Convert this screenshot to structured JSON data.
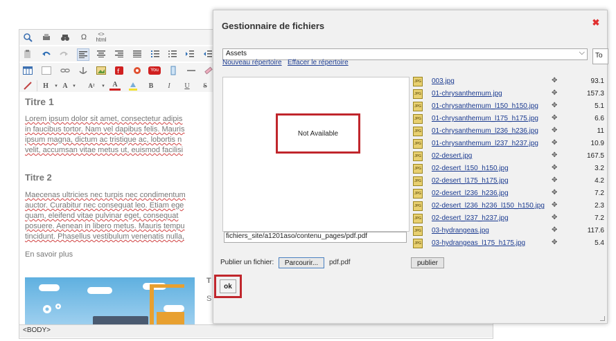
{
  "editor": {
    "heading1": "Titre 1",
    "para1_line1": "Lorem ipsum dolor sit amet, consectetur adipis",
    "para1_line2": "in faucibus tortor. Nam vel dapibus felis. Mauris",
    "para1_line3": "ipsum magna, dictum ac tristique ac, lobortis n",
    "para1_line4": "velit, accumsan vitae metus ut, euismod facilisi",
    "heading2": "Titre 2",
    "para2_line1": "Maecenas ultricies nec turpis nec condimentum",
    "para2_line2": "auctor. Curabitur nec consequat leo. Etiam ege",
    "para2_line3": "quam, eleifend vitae pulvinar eget, consequat",
    "para2_line4": "posuere. Aenean in libero metus. Mauris tempu",
    "para2_line5": "tincidunt. Phasellus vestibulum venenatis nulla,",
    "more_text": "En savoir plus",
    "side_heading": "T",
    "side_text": "S",
    "status_path": "<BODY>",
    "toolbar_icons": {
      "html": "html",
      "omega": "Ω",
      "h": "H",
      "a": "A",
      "a2": "A²",
      "b": "B",
      "i": "I",
      "u": "U",
      "s": "S",
      "you": "You"
    }
  },
  "dialog": {
    "title": "Gestionnaire de fichiers",
    "close_glyph": "✖",
    "folder_value": "Assets",
    "folder_arrow": "⌵",
    "second_select_value": "To",
    "new_folder_link": "Nouveau répertoire",
    "delete_folder_link": "Effacer le répertoire",
    "not_available": "Not Available",
    "path_value": "fichiers_site/a1201aso/contenu_pages/pdf.pdf",
    "upload_label": "Publier un fichier:",
    "browse_button": "Parcourir...",
    "selected_file": "pdf.pdf",
    "publish_button": "publier",
    "ok_button": "ok",
    "file_icon_label": "JPG",
    "action_glyph": "✥",
    "files": [
      {
        "name": "003.jpg",
        "size": "93.1"
      },
      {
        "name": "01-chrysanthemum.jpg",
        "size": "157.3"
      },
      {
        "name": "01-chrysanthemum_l150_h150.jpg",
        "size": "5.1"
      },
      {
        "name": "01-chrysanthemum_l175_h175.jpg",
        "size": "6.6"
      },
      {
        "name": "01-chrysanthemum_l236_h236.jpg",
        "size": "11"
      },
      {
        "name": "01-chrysanthemum_l237_h237.jpg",
        "size": "10.9"
      },
      {
        "name": "02-desert.jpg",
        "size": "167.5"
      },
      {
        "name": "02-desert_l150_h150.jpg",
        "size": "3.2"
      },
      {
        "name": "02-desert_l175_h175.jpg",
        "size": "4.2"
      },
      {
        "name": "02-desert_l236_h236.jpg",
        "size": "7.2"
      },
      {
        "name": "02-desert_l236_h236_l150_h150.jpg",
        "size": "2.3"
      },
      {
        "name": "02-desert_l237_h237.jpg",
        "size": "7.2"
      },
      {
        "name": "03-hydrangeas.jpg",
        "size": "117.6"
      },
      {
        "name": "03-hydrangeas_l175_h175.jpg",
        "size": "5.4"
      }
    ]
  }
}
